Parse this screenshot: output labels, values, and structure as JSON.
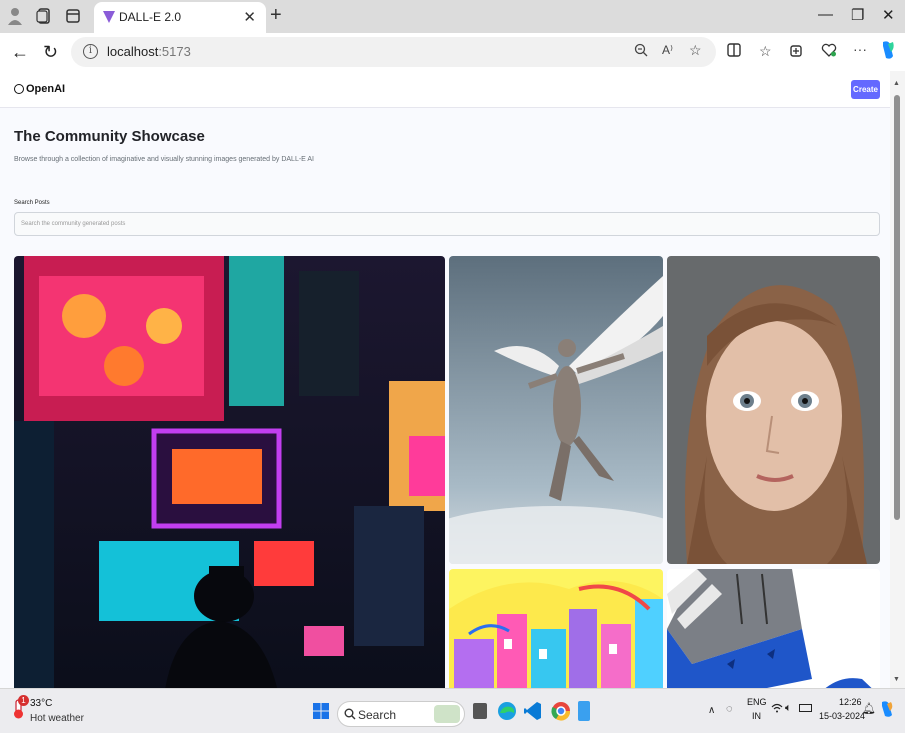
{
  "browser": {
    "tab_title": "DALL-E 2.0",
    "url_host": "localhost",
    "url_port": ":5173"
  },
  "site": {
    "logo_text": "OpenAI",
    "create_label": "Create",
    "heading": "The Community Showcase",
    "subheading": "Browse through a collection of imaginative and visually stunning images generated by DALL-E AI",
    "search_label": "Search Posts",
    "search_placeholder": "Search the community generated posts"
  },
  "gallery": [
    {
      "name": "neon-city-street-image"
    },
    {
      "name": "winged-figure-image"
    },
    {
      "name": "woman-portrait-image"
    },
    {
      "name": "colorful-city-drawing-image"
    },
    {
      "name": "blue-vehicle-illustration-image"
    }
  ],
  "taskbar": {
    "temperature": "33°C",
    "weather": "Hot weather",
    "weather_badge": "1",
    "search_label": "Search",
    "lang_primary": "ENG",
    "lang_secondary": "IN",
    "time": "12:26",
    "date": "15-03-2024"
  },
  "colors": {
    "accent": "#6469ff",
    "page_bg": "#f9fafe",
    "heading": "#222328"
  }
}
